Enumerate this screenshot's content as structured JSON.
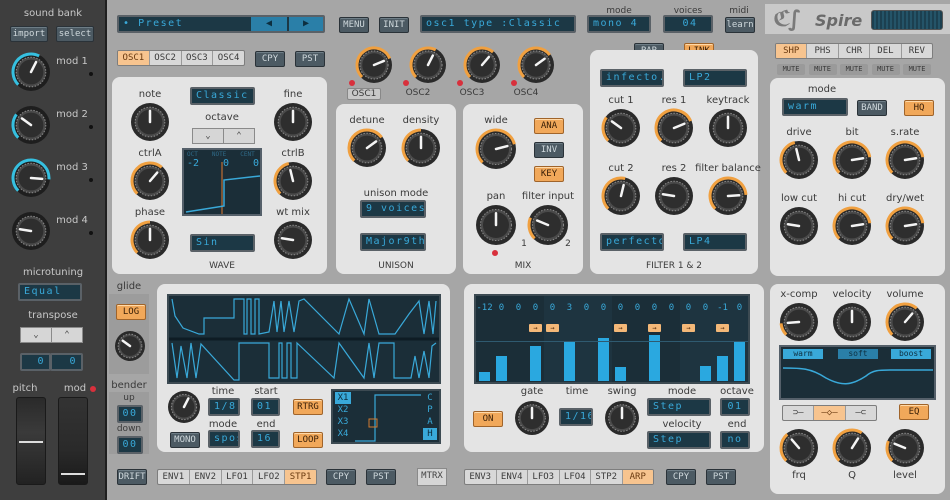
{
  "app": {
    "title": "Spire"
  },
  "left": {
    "sound_bank_title": "sound bank",
    "import_label": "import",
    "select_label": "select",
    "mods": [
      {
        "label": "mod 1",
        "value": 0.6
      },
      {
        "label": "mod 2",
        "value": 0.3
      },
      {
        "label": "mod 3",
        "value": 0.85
      },
      {
        "label": "mod 4",
        "value": 0.2
      }
    ],
    "microtuning_title": "microtuning",
    "microtuning_value": "Equal",
    "transpose_title": "transpose",
    "transpose_values": [
      "0",
      "0"
    ],
    "pitch_label": "pitch",
    "mod_label": "mod"
  },
  "top": {
    "preset_label": "Preset",
    "menu_label": "MENU",
    "init_label": "INIT",
    "info_display": "osc1 type    :Classic",
    "mode_label": "mode",
    "mode_value": "mono 4",
    "voices_label": "voices",
    "voices_value": "04",
    "midi_label": "midi",
    "learn_label": "learn"
  },
  "osc": {
    "tabs": [
      "OSC1",
      "OSC2",
      "OSC3",
      "OSC4"
    ],
    "selected_tab": 0,
    "copy_label": "CPY",
    "paste_label": "PST",
    "level_knobs": [
      {
        "label": "OSC1",
        "value": 0.75
      },
      {
        "label": "OSC2",
        "value": 0.6
      },
      {
        "label": "OSC3",
        "value": 0.65
      },
      {
        "label": "OSC4",
        "value": 0.7
      }
    ],
    "wave_panel": {
      "title": "WAVE",
      "type_value": "Classic",
      "octave_label": "octave",
      "wave_value": "Sin",
      "display_headers": [
        "OCT",
        "NOTE",
        "CENT"
      ],
      "display_values": [
        "-2",
        "0",
        "0"
      ],
      "knobs": [
        {
          "label": "note",
          "value": 0.5
        },
        {
          "label": "fine",
          "value": 0.5
        },
        {
          "label": "ctrlA",
          "value": 0.65
        },
        {
          "label": "ctrlB",
          "value": 0.45
        },
        {
          "label": "phase",
          "value": 0.5
        },
        {
          "label": "wt mix",
          "value": 0.2
        }
      ]
    },
    "unison_panel": {
      "title": "UNISON",
      "knobs": [
        {
          "label": "detune",
          "value": 0.7
        },
        {
          "label": "density",
          "value": 0.5
        }
      ],
      "mode_label": "unison mode",
      "voices_value": "9 voices",
      "chord_value": "Major9th"
    },
    "mix_panel": {
      "title": "MIX",
      "knobs": [
        {
          "label": "wide",
          "value": 0.78
        },
        {
          "label": "pan",
          "value": 0.5
        },
        {
          "label": "filter input",
          "value": 0.25
        }
      ],
      "filter_input_min": "1",
      "filter_input_max": "2",
      "buttons": [
        {
          "label": "ANA",
          "on": true
        },
        {
          "label": "INV",
          "on": false
        },
        {
          "label": "KEY",
          "on": true
        }
      ]
    }
  },
  "filter": {
    "title": "FILTER 1 & 2",
    "par_label": "PAR",
    "link_label": "LINK",
    "type1": "infecto.",
    "mode1": "LP2",
    "type2": "perfecto",
    "mode2": "LP4",
    "knobs": [
      {
        "label": "cut 1",
        "value": 0.3
      },
      {
        "label": "res 1",
        "value": 0.75
      },
      {
        "label": "keytrack",
        "value": 0.5
      },
      {
        "label": "cut 2",
        "value": 0.55
      },
      {
        "label": "res 2",
        "value": 0.2
      },
      {
        "label": "filter balance",
        "value": 0.82
      }
    ]
  },
  "fx": {
    "tabs": [
      "SHP",
      "PHS",
      "CHR",
      "DEL",
      "REV"
    ],
    "selected_tab": 0,
    "mute_label": "MUTE",
    "mode_label": "mode",
    "mode_value": "warm",
    "band_label": "BAND",
    "hq_label": "HQ",
    "knobs": [
      {
        "label": "drive",
        "value": 0.45
      },
      {
        "label": "bit",
        "value": 0.8
      },
      {
        "label": "s.rate",
        "value": 0.8
      },
      {
        "label": "low cut",
        "value": 0.2
      },
      {
        "label": "hi cut",
        "value": 0.8
      },
      {
        "label": "dry/wet",
        "value": 0.8
      }
    ]
  },
  "output": {
    "knobs": [
      {
        "label": "x-comp",
        "value": 0.15
      },
      {
        "label": "velocity",
        "value": 0.5
      },
      {
        "label": "volume",
        "value": 0.65
      }
    ],
    "eq_tabs": [
      "warm",
      "soft",
      "boost"
    ],
    "eq_shapes": [
      "low-shelf-icon",
      "peak-icon",
      "high-shelf-icon"
    ],
    "eq_selected_shape": 1,
    "eq_label": "EQ",
    "eq_knobs": [
      {
        "label": "frq",
        "value": 0.35
      },
      {
        "label": "Q",
        "value": 0.62
      },
      {
        "label": "level",
        "value": 0.25
      }
    ]
  },
  "glide": {
    "title": "glide",
    "log_label": "LOG",
    "knob_value": 0.3,
    "bender_title": "bender",
    "up_label": "up",
    "up_value": "00",
    "down_label": "down",
    "down_value": "00"
  },
  "mod1": {
    "time_label": "time",
    "time_value": "1/8",
    "start_label": "start",
    "start_value": "01",
    "rtrg_label": "RTRG",
    "mode_label": "mode",
    "mode_value": "spos",
    "end_label": "end",
    "end_value": "16",
    "loop_label": "LOOP",
    "mono_label": "MONO",
    "knob_value": 0.6,
    "x_labels": [
      "X1",
      "X2",
      "X3",
      "X4"
    ],
    "x_selected": 0,
    "side_labels": [
      "C",
      "P",
      "A",
      "H"
    ],
    "side_selected": 3,
    "tabs": [
      "ENV1",
      "ENV2",
      "LFO1",
      "LFO2",
      "STP1"
    ],
    "selected_tab": 4,
    "drift_label": "DRIFT",
    "copy_label": "CPY",
    "paste_label": "PST",
    "matrix_label": "MTRX"
  },
  "arp": {
    "steps_transpose": [
      "-12",
      "0",
      "0",
      "0",
      "0",
      "3",
      "0",
      "0",
      "0",
      "0",
      "0",
      "0",
      "0",
      "0",
      "-1",
      "0"
    ],
    "steps_tie": [
      false,
      false,
      false,
      true,
      true,
      false,
      false,
      false,
      true,
      false,
      true,
      false,
      true,
      false,
      true,
      false
    ],
    "steps_velocity": [
      0.12,
      0.32,
      0,
      0.45,
      0,
      0.52,
      0,
      0.55,
      0.18,
      0,
      0.6,
      0,
      0,
      0.2,
      0.32,
      0.52
    ],
    "on_label": "ON",
    "gate_label": "gate",
    "gate_value": 0.5,
    "time_label": "time",
    "time_value": "1/16",
    "swing_label": "swing",
    "swing_value": 0.5,
    "mode_label": "mode",
    "mode_value": "Step",
    "octave_label": "octave",
    "octave_value": "01",
    "velocity_label": "velocity",
    "velocity_value": "Step",
    "end_label": "end",
    "end_value": "no",
    "tabs": [
      "ENV3",
      "ENV4",
      "LFO3",
      "LFO4",
      "STP2",
      "ARP"
    ],
    "selected_tab": 5,
    "copy_label": "CPY",
    "paste_label": "PST"
  },
  "colors": {
    "accent_orange": "#f0a040",
    "lcd_blue": "#39a9d9",
    "mod_cyan": "#36c0e0",
    "led_red": "#d8303c"
  }
}
